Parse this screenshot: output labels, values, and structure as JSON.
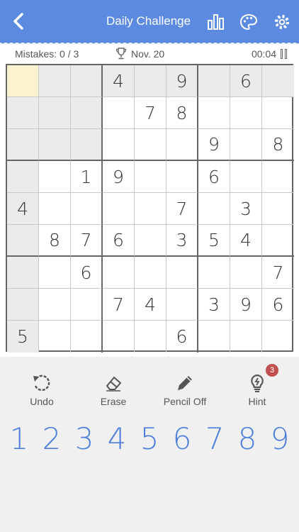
{
  "header": {
    "title": "Daily Challenge",
    "bg_color": "#5b8ae0",
    "icons": [
      "back-chevron-icon",
      "stats-bars-icon",
      "palette-icon",
      "gear-icon"
    ]
  },
  "info": {
    "mistakes": "Mistakes: 0 / 3",
    "date": "Nov. 20",
    "timer": "00:04"
  },
  "board": {
    "rows": [
      [
        "",
        "",
        "",
        "4",
        "",
        "9",
        "",
        "6",
        ""
      ],
      [
        "",
        "",
        "",
        "",
        "7",
        "8",
        "",
        "",
        ""
      ],
      [
        "",
        "",
        "",
        "",
        "",
        "",
        "9",
        "",
        "8"
      ],
      [
        "",
        "",
        "1",
        "9",
        "",
        "",
        "6",
        "",
        ""
      ],
      [
        "4",
        "",
        "",
        "",
        "",
        "7",
        "",
        "3",
        ""
      ],
      [
        "",
        "8",
        "7",
        "6",
        "",
        "3",
        "5",
        "4",
        ""
      ],
      [
        "",
        "",
        "6",
        "",
        "",
        "",
        "",
        "",
        "7"
      ],
      [
        "",
        "",
        "",
        "7",
        "4",
        "",
        "3",
        "9",
        "6"
      ],
      [
        "5",
        "",
        "",
        "",
        "",
        "6",
        "",
        "",
        ""
      ]
    ],
    "selected": [
      0,
      0
    ],
    "selected_color": "#fbf2cf",
    "highlight_color": "#ebebeb"
  },
  "tools": {
    "undo": "Undo",
    "erase": "Erase",
    "pencil": "Pencil Off",
    "hint": "Hint",
    "hint_count": "3"
  },
  "numpad": [
    "1",
    "2",
    "3",
    "4",
    "5",
    "6",
    "7",
    "8",
    "9"
  ],
  "accent_color": "#4d7fdc"
}
